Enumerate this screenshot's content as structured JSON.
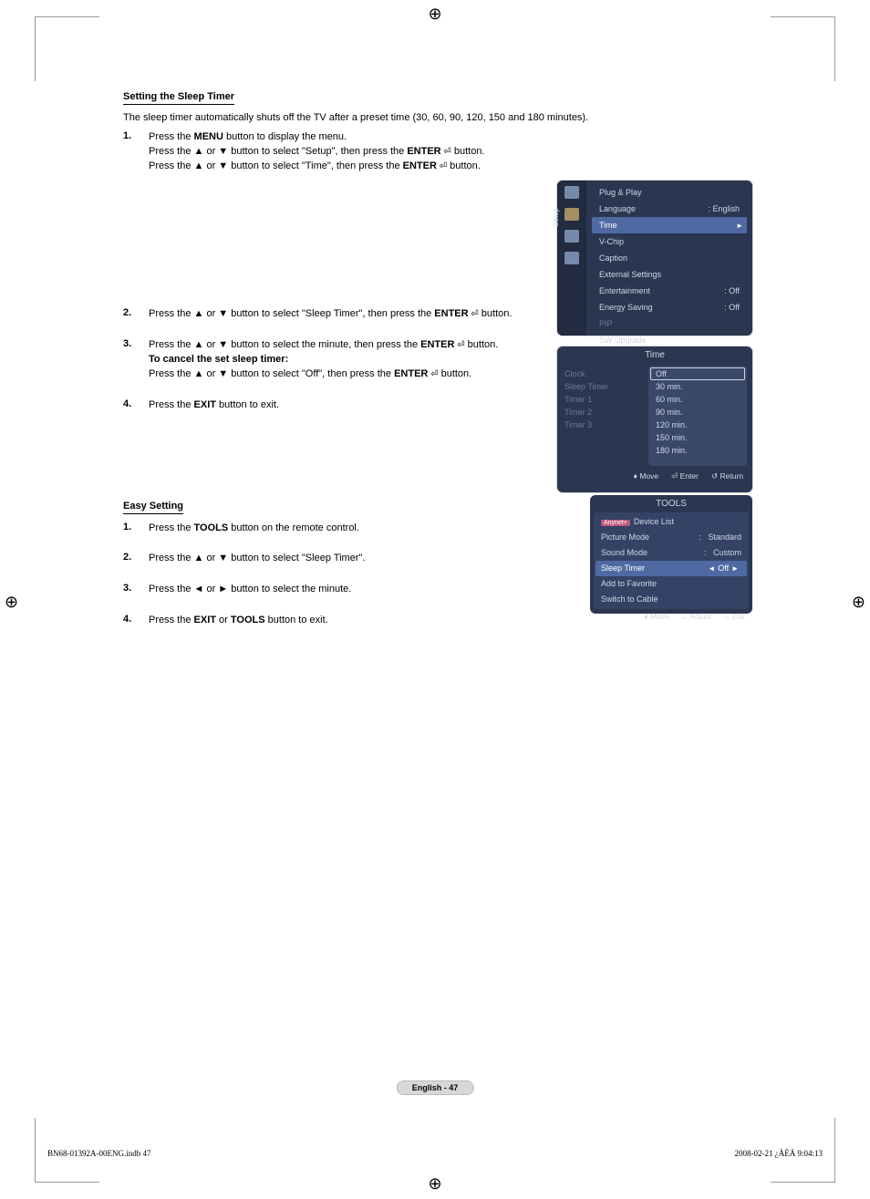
{
  "section1": {
    "title": "Setting the Sleep Timer",
    "intro": "The sleep timer automatically shuts off the TV after a preset time (30, 60, 90, 120, 150 and 180 minutes).",
    "step1_a": "Press the ",
    "step1_menu": "MENU",
    "step1_b": " button to display the menu.",
    "step1_c": "Press the ▲ or ▼ button to select \"Setup\", then press the ",
    "step1_d": "ENTER",
    "step1_e": " button.",
    "step1_f": "Press the ▲ or ▼ button to select \"Time\", then press the ",
    "step1_g": "ENTER",
    "step1_h": " button.",
    "step2_a": "Press the ▲ or ▼ button to select \"Sleep Timer\", then press the ",
    "step2_b": "ENTER",
    "step2_c": " button.",
    "step3_a": "Press the ▲ or ▼ button to select the minute, then press the ",
    "step3_b": "ENTER",
    "step3_c": " button.",
    "step3_cancel": "To cancel the set sleep timer:",
    "step3_d": "Press the ▲ or ▼ button to select \"Off\", then press the ",
    "step3_e": "ENTER",
    "step3_f": " button.",
    "step4_a": "Press the ",
    "step4_b": "EXIT",
    "step4_c": " button to exit."
  },
  "section2": {
    "title": "Easy Setting",
    "s1_a": "Press the ",
    "s1_b": "TOOLS",
    "s1_c": " button on the remote control.",
    "s2": "Press the ▲ or ▼ button to select \"Sleep Timer\".",
    "s3": "Press the ◄ or ► button to select the minute.",
    "s4_a": "Press the ",
    "s4_b": "EXIT",
    "s4_c": " or ",
    "s4_d": "TOOLS",
    "s4_e": " button to exit."
  },
  "osd_setup": {
    "vlabel": "Setup",
    "rows": {
      "plug": "Plug & Play",
      "lang": "Language",
      "lang_v": ": English",
      "time": "Time",
      "vchip": "V-Chip",
      "caption": "Caption",
      "ext": "External Settings",
      "ent": "Entertainment",
      "ent_v": ": Off",
      "energy": "Energy Saving",
      "energy_v": ": Off",
      "pip": "PIP",
      "sw": "SW Upgrade"
    }
  },
  "osd_time": {
    "title": "Time",
    "left": {
      "clock": "Clock",
      "sleep": "Sleep Timer",
      "t1": "Timer 1",
      "t2": "Timer 2",
      "t3": "Timer 3"
    },
    "opts": {
      "off": "Off",
      "30": "30 min.",
      "60": "60 min.",
      "90": "90 min.",
      "120": "120 min.",
      "150": "150 min.",
      "180": "180 min."
    },
    "footer": {
      "move": "Move",
      "enter": "Enter",
      "ret": "Return"
    }
  },
  "osd_tools": {
    "title": "TOOLS",
    "anynet": "Anynet+",
    "rows": {
      "device": "Device List",
      "pic": "Picture Mode",
      "pic_v": "Standard",
      "sound": "Sound Mode",
      "sound_v": "Custom",
      "sleep": "Sleep Timer",
      "sleep_v": "Off",
      "fav": "Add to Favorite",
      "cable": "Switch to Cable"
    },
    "footer": {
      "move": "Move",
      "adjust": "Adjust",
      "exit": "Exit"
    }
  },
  "badge": "English - 47",
  "footer_left": "BN68-01392A-00ENG.indb   47",
  "footer_right": "2008-02-21   ¿ÀÈÄ 9:04:13",
  "nums": {
    "n1": "1.",
    "n2": "2.",
    "n3": "3.",
    "n4": "4."
  },
  "glyph": {
    "enter": " ",
    "updown": "♦",
    "leftright": "↔",
    "ret": "↺",
    "exit": "→"
  }
}
